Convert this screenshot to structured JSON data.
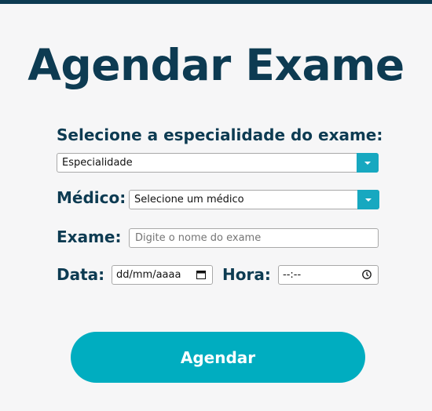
{
  "page": {
    "title": "Agendar Exame"
  },
  "form": {
    "especialidade_label": "Selecione a especialidade do exame:",
    "especialidade_value": "Especialidade",
    "medico_label": "Médico:",
    "medico_value": "Selecione um médico",
    "exame_label": "Exame:",
    "exame_placeholder": "Digite o nome do exame",
    "data_label": "Data:",
    "data_value": "dd/mm/aaaa",
    "hora_label": "Hora:",
    "hora_value": "--:--",
    "submit_label": "Agendar"
  },
  "icons": {
    "dropdown": "chevron-down-icon",
    "calendar": "calendar-icon",
    "clock": "clock-icon"
  },
  "colors": {
    "primary_dark": "#0d3b52",
    "accent": "#00adc0",
    "dropdown_accent": "#17a8c0",
    "background": "#f6f6f7"
  }
}
